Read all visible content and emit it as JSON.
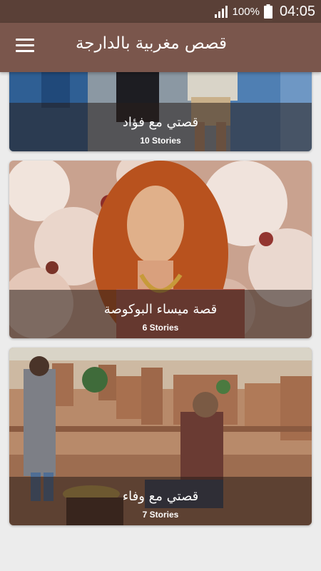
{
  "status_bar": {
    "battery_percent": "100%",
    "time": "04:05",
    "icons": [
      "signal-icon",
      "battery-icon"
    ]
  },
  "app_bar": {
    "title": "قصص مغربية بالدارجة",
    "menu_icon": "hamburger-menu-icon",
    "color": "#7a564c"
  },
  "stories": [
    {
      "title": "قصتي مع فؤاد",
      "count": "10 Stories"
    },
    {
      "title": "قصة ميساء البوكوصة",
      "count": "6 Stories"
    },
    {
      "title": "قصتي مع وفاء",
      "count": "7 Stories"
    }
  ]
}
